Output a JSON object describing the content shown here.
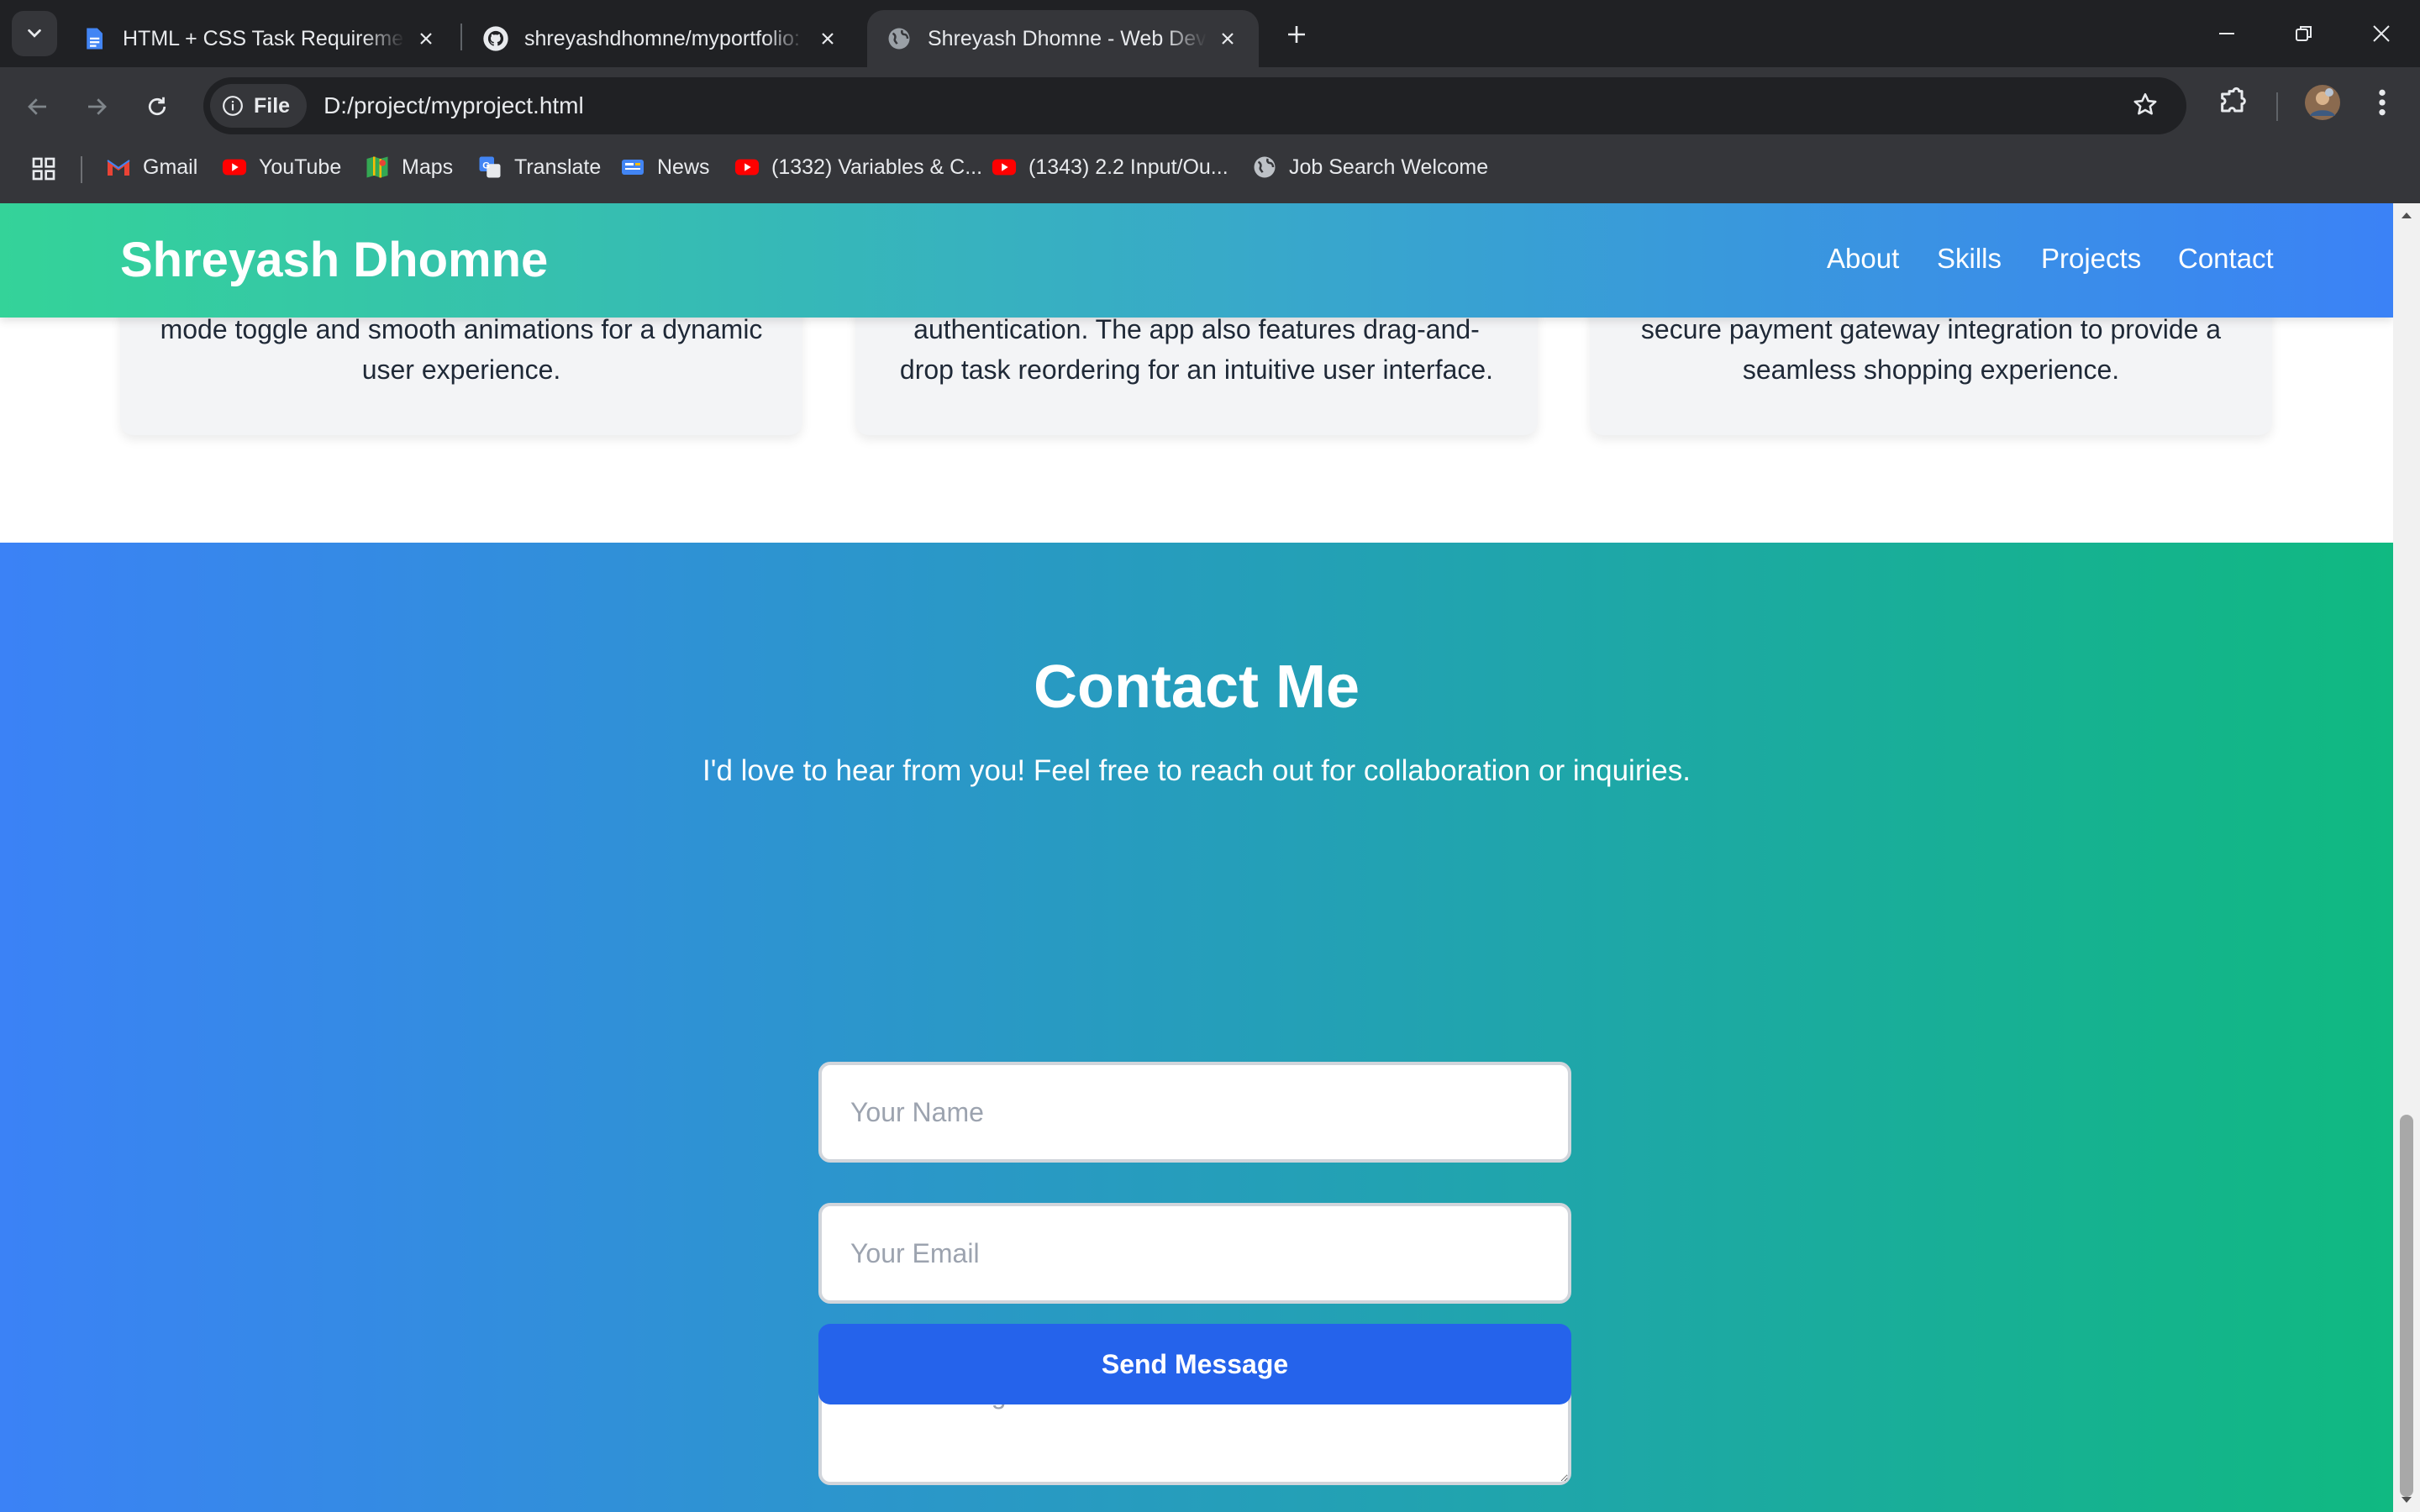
{
  "browser": {
    "tabs": [
      {
        "title": "HTML + CSS Task Requirements",
        "active": false,
        "icon": "google-docs-icon"
      },
      {
        "title": "shreyashdhomne/myportfolio: F",
        "active": false,
        "icon": "github-icon"
      },
      {
        "title": "Shreyash Dhomne - Web Devel",
        "active": true,
        "icon": "globe-icon"
      }
    ],
    "address": {
      "chip_label": "File",
      "url": "D:/project/myproject.html"
    },
    "bookmarks": [
      {
        "label": "Gmail",
        "icon": "gmail-icon"
      },
      {
        "label": "YouTube",
        "icon": "youtube-icon"
      },
      {
        "label": "Maps",
        "icon": "maps-icon"
      },
      {
        "label": "Translate",
        "icon": "translate-icon"
      },
      {
        "label": "News",
        "icon": "news-icon"
      },
      {
        "label": "(1332) Variables & C...",
        "icon": "youtube-icon"
      },
      {
        "label": "(1343) 2.2 Input/Ou...",
        "icon": "youtube-icon"
      },
      {
        "label": "Job Search Welcome",
        "icon": "globe-icon"
      }
    ]
  },
  "site": {
    "brand": "Shreyash Dhomne",
    "nav": [
      "About",
      "Skills",
      "Projects",
      "Contact"
    ],
    "colors": {
      "header_start": "#34d399",
      "header_end": "#3b82f6",
      "contact_start": "#3b82f6",
      "contact_end": "#10b981",
      "button": "#2563eb"
    }
  },
  "projects": {
    "cards": [
      {
        "text": "mode toggle and smooth animations for a dynamic user experience."
      },
      {
        "text": "authentication. The app also features drag-and-drop task reordering for an intuitive user interface."
      },
      {
        "text": "secure payment gateway integration to provide a seamless shopping experience."
      }
    ]
  },
  "contact": {
    "title": "Contact Me",
    "lead": "I'd love to hear from you! Feel free to reach out for collaboration or inquiries.",
    "name_placeholder": "Your Name",
    "email_placeholder": "Your Email",
    "message_placeholder": "Your Message",
    "submit_label": "Send Message"
  }
}
